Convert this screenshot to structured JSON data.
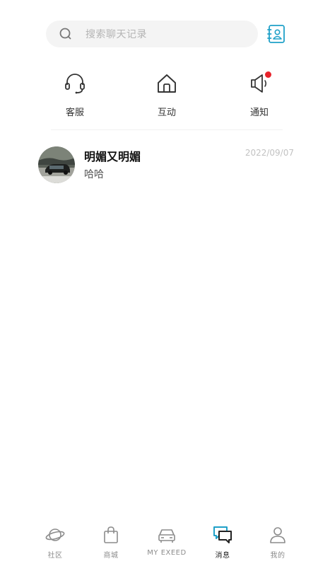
{
  "search": {
    "placeholder": "搜索聊天记录"
  },
  "quick_actions": [
    {
      "label": "客服",
      "icon": "headset-icon"
    },
    {
      "label": "互动",
      "icon": "home-icon"
    },
    {
      "label": "通知",
      "icon": "megaphone-icon",
      "has_badge": true
    }
  ],
  "conversations": [
    {
      "name": "明媚又明媚",
      "preview": "哈哈",
      "date": "2022/09/07"
    }
  ],
  "tabbar": {
    "active_index": 3,
    "accent_color": "#1fa0c8",
    "items": [
      {
        "label": "社区",
        "icon": "planet-icon"
      },
      {
        "label": "商城",
        "icon": "shopping-bag-icon"
      },
      {
        "label": "MY EXEED",
        "icon": "car-icon"
      },
      {
        "label": "消息",
        "icon": "chat-bubbles-icon"
      },
      {
        "label": "我的",
        "icon": "person-icon"
      }
    ]
  },
  "colors": {
    "badge": "#e8242c",
    "search_background": "#f4f4f4",
    "accent": "#1fa0c8"
  }
}
